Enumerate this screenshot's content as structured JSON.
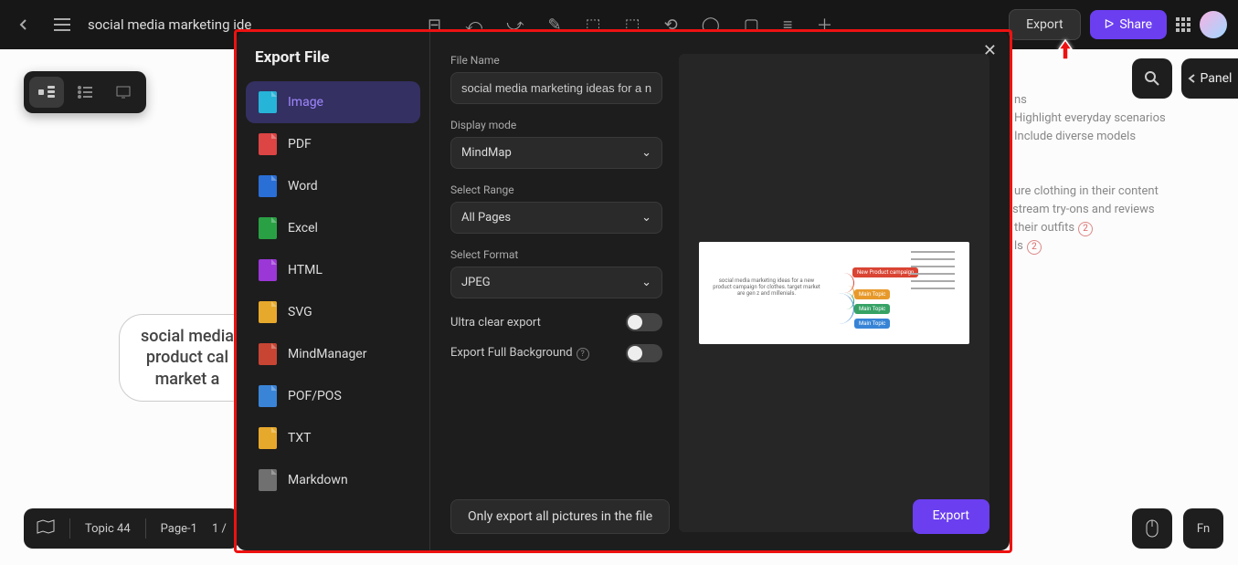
{
  "header": {
    "title": "social media marketing ide",
    "export_btn": "Export",
    "share_btn": "Share",
    "panel_label": "Panel"
  },
  "canvas": {
    "center_node": "social media product cal market a",
    "right_texts": {
      "r1": "ns",
      "r2": "Highlight everyday scenarios",
      "r3": "Include diverse models",
      "r4": "ure clothing in their content",
      "r5": "stream try-ons and reviews",
      "r6": "their outfits",
      "r7": "ls",
      "badge6": "2",
      "badge7": "2"
    }
  },
  "status": {
    "topic": "Topic 44",
    "page": "Page-1",
    "page_num": "1 /"
  },
  "corner": {
    "fn": "Fn"
  },
  "modal": {
    "title": "Export File",
    "formats": [
      "Image",
      "PDF",
      "Word",
      "Excel",
      "HTML",
      "SVG",
      "MindManager",
      "POF/POS",
      "TXT",
      "Markdown"
    ],
    "active_format_index": 0,
    "form": {
      "file_name_label": "File Name",
      "file_name_value": "social media marketing ideas for a nev",
      "display_mode_label": "Display mode",
      "display_mode_value": "MindMap",
      "select_range_label": "Select Range",
      "select_range_value": "All Pages",
      "select_format_label": "Select Format",
      "select_format_value": "JPEG",
      "ultra_clear_label": "Ultra clear export",
      "ultra_clear_on": false,
      "full_bg_label": "Export Full Background",
      "full_bg_on": false
    },
    "preview": {
      "center_text": "social media marketing ideas for a new product campaign for clothes. target market are gen z and millenials.",
      "tags": [
        "New Product campaign",
        "Main Topic",
        "Main Topic",
        "Main Topic"
      ]
    },
    "buttons": {
      "secondary": "Only export all pictures in the file",
      "primary": "Export"
    }
  }
}
